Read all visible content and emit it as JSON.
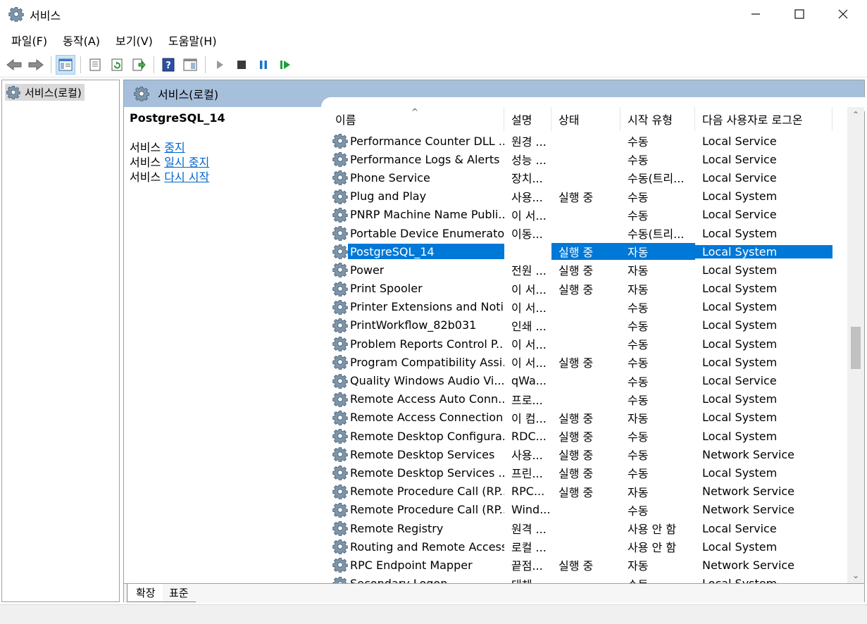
{
  "window": {
    "title": "서비스"
  },
  "menu": [
    "파일(F)",
    "동작(A)",
    "보기(V)",
    "도움말(H)"
  ],
  "toolbar": {
    "icons": [
      "back-arrow-icon",
      "forward-arrow-icon",
      "console-tree-icon",
      "properties-icon",
      "refresh-icon",
      "export-list-icon",
      "help-icon",
      "show-hide-action-pane-icon",
      "start-service-icon",
      "stop-service-icon",
      "pause-service-icon",
      "restart-service-icon"
    ]
  },
  "tree": {
    "root_label": "서비스(로컬)"
  },
  "main": {
    "header_title": "서비스(로컬)",
    "selected_service": "PostgreSQL_14",
    "actions": [
      {
        "prefix": "서비스",
        "link": "중지"
      },
      {
        "prefix": "서비스",
        "link": "일시 중지"
      },
      {
        "prefix": "서비스",
        "link": "다시 시작"
      }
    ]
  },
  "columns": {
    "name": "이름",
    "desc": "설명",
    "status": "상태",
    "startup": "시작 유형",
    "logon": "다음 사용자로 로그온"
  },
  "rows": [
    {
      "name": "Performance Counter DLL ...",
      "desc": "원경 ...",
      "status": "",
      "startup": "수동",
      "logon": "Local Service"
    },
    {
      "name": "Performance Logs & Alerts",
      "desc": "성능 ...",
      "status": "",
      "startup": "수동",
      "logon": "Local Service"
    },
    {
      "name": "Phone Service",
      "desc": "장치...",
      "status": "",
      "startup": "수동(트리...",
      "logon": "Local Service"
    },
    {
      "name": "Plug and Play",
      "desc": "사용...",
      "status": "실행 중",
      "startup": "수동",
      "logon": "Local System"
    },
    {
      "name": "PNRP Machine Name Publi...",
      "desc": "이 서...",
      "status": "",
      "startup": "수동",
      "logon": "Local Service"
    },
    {
      "name": "Portable Device Enumerato...",
      "desc": "이동...",
      "status": "",
      "startup": "수동(트리...",
      "logon": "Local System"
    },
    {
      "name": "PostgreSQL_14",
      "desc": "",
      "status": "실행 중",
      "startup": "자동",
      "logon": "Local System",
      "selected": true
    },
    {
      "name": "Power",
      "desc": "전원 ...",
      "status": "실행 중",
      "startup": "자동",
      "logon": "Local System"
    },
    {
      "name": "Print Spooler",
      "desc": "이 서...",
      "status": "실행 중",
      "startup": "자동",
      "logon": "Local System"
    },
    {
      "name": "Printer Extensions and Noti...",
      "desc": "이 서...",
      "status": "",
      "startup": "수동",
      "logon": "Local System"
    },
    {
      "name": "PrintWorkflow_82b031",
      "desc": "인쇄 ...",
      "status": "",
      "startup": "수동",
      "logon": "Local System"
    },
    {
      "name": "Problem Reports Control P...",
      "desc": "이 서...",
      "status": "",
      "startup": "수동",
      "logon": "Local System"
    },
    {
      "name": "Program Compatibility Assi...",
      "desc": "이 서...",
      "status": "실행 중",
      "startup": "수동",
      "logon": "Local System"
    },
    {
      "name": "Quality Windows Audio Vi...",
      "desc": "qWa...",
      "status": "",
      "startup": "수동",
      "logon": "Local Service"
    },
    {
      "name": "Remote Access Auto Conn...",
      "desc": "프로...",
      "status": "",
      "startup": "수동",
      "logon": "Local System"
    },
    {
      "name": "Remote Access Connection...",
      "desc": "이 컴...",
      "status": "실행 중",
      "startup": "자동",
      "logon": "Local System"
    },
    {
      "name": "Remote Desktop Configura...",
      "desc": "RDC...",
      "status": "실행 중",
      "startup": "수동",
      "logon": "Local System"
    },
    {
      "name": "Remote Desktop Services",
      "desc": "사용...",
      "status": "실행 중",
      "startup": "수동",
      "logon": "Network Service"
    },
    {
      "name": "Remote Desktop Services ...",
      "desc": "프린...",
      "status": "실행 중",
      "startup": "수동",
      "logon": "Local System"
    },
    {
      "name": "Remote Procedure Call (RP...",
      "desc": "RPC...",
      "status": "실행 중",
      "startup": "자동",
      "logon": "Network Service"
    },
    {
      "name": "Remote Procedure Call (RP...",
      "desc": "Wind...",
      "status": "",
      "startup": "수동",
      "logon": "Network Service"
    },
    {
      "name": "Remote Registry",
      "desc": "원격 ...",
      "status": "",
      "startup": "사용 안 함",
      "logon": "Local Service"
    },
    {
      "name": "Routing and Remote Access",
      "desc": "로컬 ...",
      "status": "",
      "startup": "사용 안 함",
      "logon": "Local System"
    },
    {
      "name": "RPC Endpoint Mapper",
      "desc": "끝점...",
      "status": "실행 중",
      "startup": "자동",
      "logon": "Network Service"
    },
    {
      "name": "Secondary Logon",
      "desc": "대체...",
      "status": "",
      "startup": "수동",
      "logon": "Local System"
    }
  ],
  "tabs": [
    "확장",
    "표준"
  ],
  "colors": {
    "selection": "#0078d7",
    "header_band": "#a6bfdb",
    "link": "#0066cc"
  }
}
